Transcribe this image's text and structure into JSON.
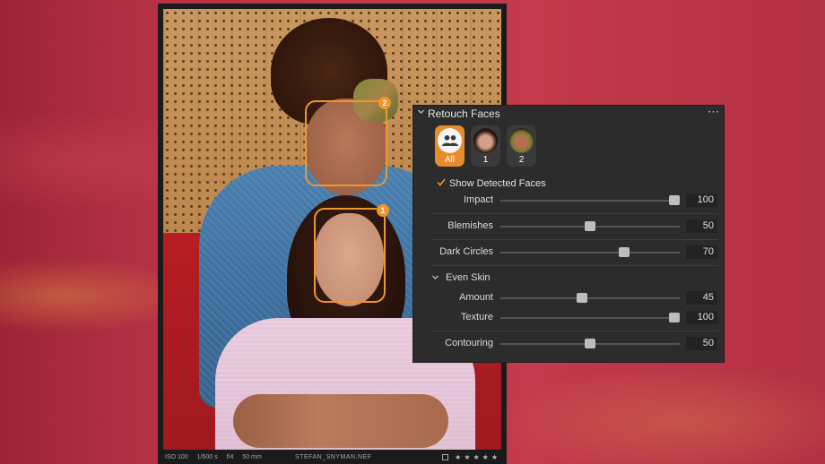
{
  "photo": {
    "info": {
      "iso": "ISO 100",
      "shutter": "1/500 s",
      "aperture": "f/4",
      "focal": "50 mm",
      "filename": "STEFAN_SNYMAN.NEF",
      "stars": [
        "★",
        "★",
        "★",
        "★",
        "★"
      ]
    },
    "face_badges": {
      "face1": "1",
      "face2": "2"
    }
  },
  "panel": {
    "title": "Retouch Faces",
    "more_icon": "⋯",
    "faces": [
      {
        "label": "All",
        "icon": "people-icon",
        "selected": true
      },
      {
        "label": "1",
        "icon": "face-thumbnail",
        "selected": false
      },
      {
        "label": "2",
        "icon": "face-thumbnail",
        "selected": false
      }
    ],
    "show_detected": {
      "label": "Show Detected Faces",
      "checked": true
    },
    "sliders": {
      "impact": {
        "label": "Impact",
        "value": "100",
        "fraction": 1.0
      },
      "blemishes": {
        "label": "Blemishes",
        "value": "50",
        "fraction": 0.5
      },
      "dark_circles": {
        "label": "Dark Circles",
        "value": "70",
        "fraction": 0.7
      },
      "amount": {
        "label": "Amount",
        "value": "45",
        "fraction": 0.45
      },
      "texture": {
        "label": "Texture",
        "value": "100",
        "fraction": 1.0
      },
      "contouring": {
        "label": "Contouring",
        "value": "50",
        "fraction": 0.5
      }
    },
    "even_skin": {
      "label": "Even Skin",
      "expanded": true
    }
  },
  "colors": {
    "accent": "#f0962d",
    "panel_bg": "#2c2c2c",
    "background": "#c23a4b"
  }
}
